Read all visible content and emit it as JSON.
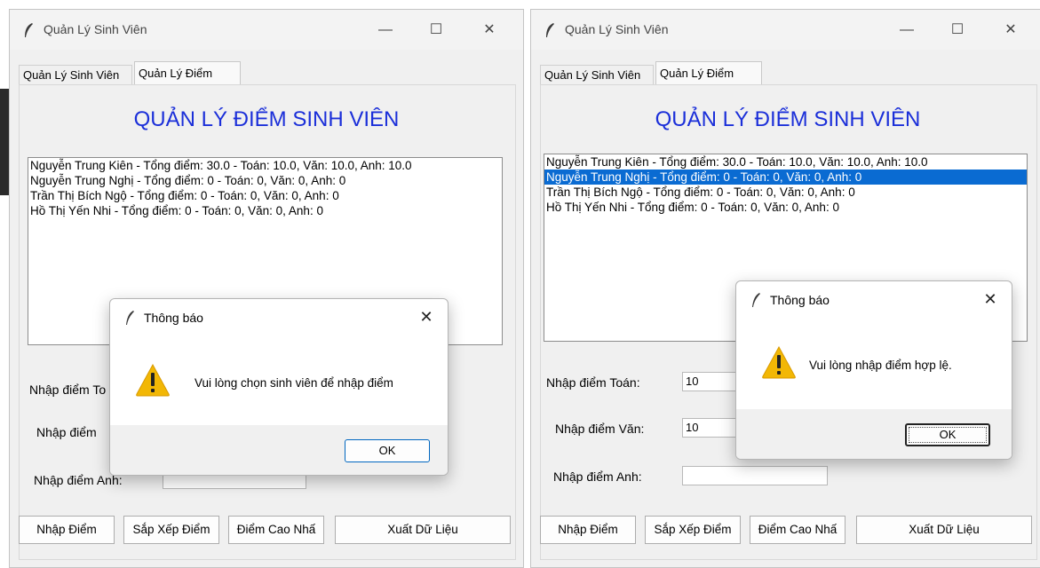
{
  "windows": [
    {
      "title": "Quản Lý Sinh Viên",
      "tabs": [
        "Quản Lý Sinh Viên",
        "Quản Lý Điểm"
      ],
      "heading": "QUẢN LÝ ĐIỂM SINH VIÊN",
      "students": [
        "Nguyễn Trung Kiên - Tổng điểm: 30.0 - Toán: 10.0, Văn: 10.0, Anh: 10.0",
        "Nguyễn Trung Nghị  - Tổng điểm: 0 - Toán: 0, Văn: 0, Anh: 0",
        "Trần Thị Bích Ngộ  - Tổng điểm: 0 - Toán: 0, Văn: 0, Anh: 0",
        "Hồ Thị Yến Nhi - Tổng điểm: 0 - Toán: 0, Văn: 0, Anh: 0"
      ],
      "selected_index": null,
      "fields": {
        "toan_label": "Nhập điểm To",
        "van_label": "Nhập điểm",
        "anh_label": "Nhập điểm Anh:",
        "toan_value": "",
        "van_value": "",
        "anh_value": ""
      },
      "buttons": [
        "Nhập Điểm",
        "Sắp Xếp Điểm",
        "Điểm Cao Nhấ",
        "Xuất Dữ Liệu"
      ],
      "dialog": {
        "title": "Thông báo",
        "message": "Vui lòng chọn sinh viên để nhập điểm",
        "ok": "OK"
      }
    },
    {
      "title": "Quản Lý Sinh Viên",
      "tabs": [
        "Quản Lý Sinh Viên",
        "Quản Lý Điểm"
      ],
      "heading": "QUẢN LÝ ĐIỂM SINH VIÊN",
      "students": [
        "Nguyễn Trung Kiên - Tổng điểm: 30.0 - Toán: 10.0, Văn: 10.0, Anh: 10.0",
        "Nguyễn Trung Nghị  - Tổng điểm: 0 - Toán: 0, Văn: 0, Anh: 0",
        "Trần Thị Bích Ngộ  - Tổng điểm: 0 - Toán: 0, Văn: 0, Anh: 0",
        "Hồ Thị Yến Nhi - Tổng điểm: 0 - Toán: 0, Văn: 0, Anh: 0"
      ],
      "selected_index": 1,
      "fields": {
        "toan_label": "Nhập điểm Toán:",
        "van_label": "Nhập điểm Văn:",
        "anh_label": "Nhập điểm Anh:",
        "toan_value": "10",
        "van_value": "10",
        "anh_value": ""
      },
      "buttons": [
        "Nhập Điểm",
        "Sắp Xếp Điểm",
        "Điểm Cao Nhấ",
        "Xuất Dữ Liệu"
      ],
      "dialog": {
        "title": "Thông báo",
        "message": "Vui lòng nhập điểm hợp lệ.",
        "ok": "OK"
      }
    }
  ],
  "window_controls": {
    "minimize": "—",
    "maximize": "☐",
    "close": "✕"
  },
  "colors": {
    "heading": "#1b2fd9",
    "selection": "#0a6bd2",
    "warning": "#f2b705"
  },
  "icons": [
    "feather-icon",
    "warning-icon"
  ]
}
